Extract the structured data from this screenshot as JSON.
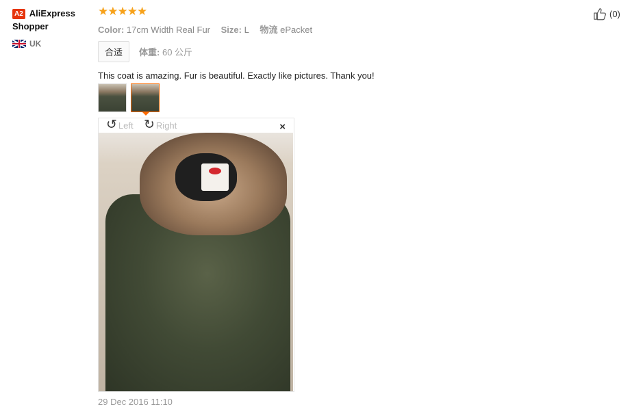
{
  "reviewer": {
    "badge": "A2",
    "name": "AliExpress Shopper",
    "country": "UK",
    "flag_icon": "uk-flag-icon"
  },
  "review": {
    "stars": "★★★★★",
    "rating": 5,
    "color_label": "Color:",
    "color_value": "17cm Width Real Fur",
    "size_label": "Size:",
    "size_value": "L",
    "shipping_label": "物流",
    "shipping_value": "ePacket",
    "fit_tag": "合适",
    "weight_label": "体重:",
    "weight_value": "60 公斤",
    "text": "This coat is amazing. Fur is beautiful. Exactly like pictures. Thank you!",
    "date": "29 Dec 2016 11:10"
  },
  "viewer": {
    "rotate_left": "Left",
    "rotate_right": "Right",
    "close": "×"
  },
  "like": {
    "count": "(0)"
  },
  "colors": {
    "star": "#f7a21b",
    "badge": "#e6350d",
    "active_thumb": "#ff6a00"
  }
}
